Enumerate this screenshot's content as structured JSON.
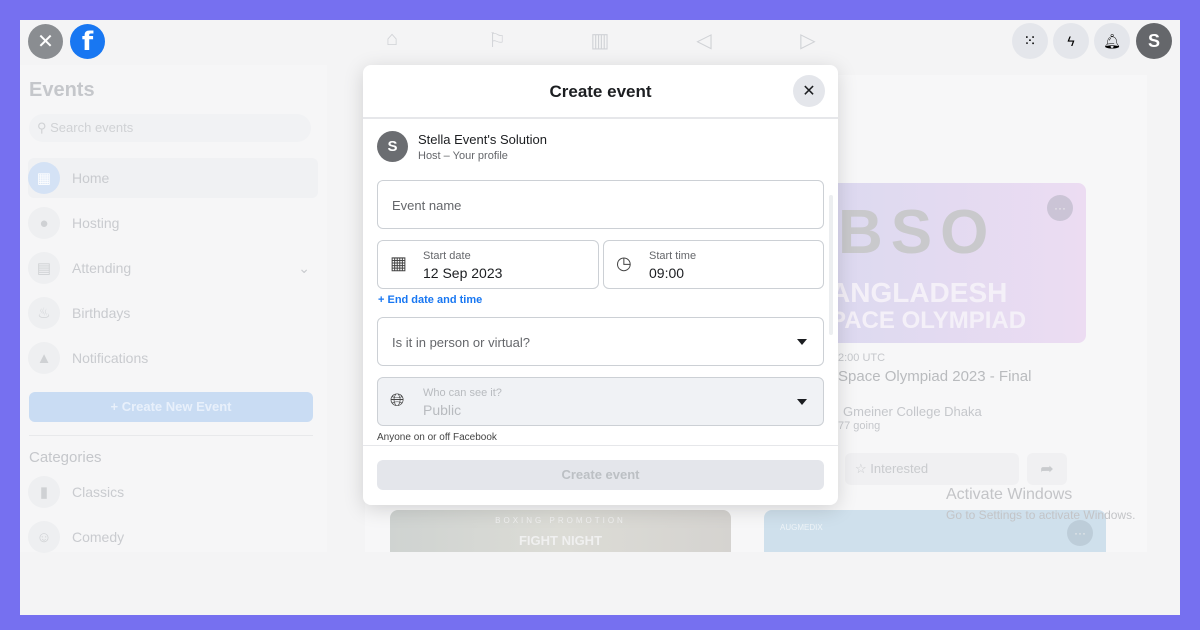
{
  "colors": {
    "border": "#7670f0",
    "accent": "#1877f2",
    "fb_blue": "#1877f2"
  },
  "topbar": {
    "close_icon": "close-icon",
    "logo": "facebook-logo",
    "nav": [
      "home-icon",
      "flag-icon",
      "chart-icon",
      "megaphone-icon",
      "video-icon"
    ],
    "right": [
      "grid-menu-icon",
      "messenger-icon",
      "bell-icon"
    ],
    "avatar_letter": "S"
  },
  "sidebar": {
    "title": "Events",
    "search_placeholder": "Search events",
    "items": [
      {
        "label": "Home",
        "icon": "calendar-icon"
      },
      {
        "label": "Hosting",
        "icon": "person-icon"
      },
      {
        "label": "Attending",
        "icon": "calendar-star-icon"
      },
      {
        "label": "Birthdays",
        "icon": "cake-icon"
      },
      {
        "label": "Notifications",
        "icon": "bell-icon"
      }
    ],
    "create_button": "+ Create New Event",
    "categories_title": "Categories",
    "categories": [
      {
        "label": "Classics",
        "icon": "book-icon"
      },
      {
        "label": "Comedy",
        "icon": "laugh-icon"
      }
    ]
  },
  "background_card": {
    "banner_line1": "BSO",
    "banner_line2": "ANGLADESH",
    "banner_line3": "PACE OLYMPIAD",
    "time": "2:00 UTC",
    "title": "Space Olympiad 2023 - Final",
    "location": "Gmeiner College Dhaka",
    "going": "77 going",
    "interested": "Interested"
  },
  "bottom_cards": {
    "card1_top": "BOXING PROMOTION",
    "card1_title": "FIGHT NIGHT",
    "card2_brand": "AUGMEDIX"
  },
  "watermark": {
    "title": "Activate Windows",
    "subtitle": "Go to Settings to activate Windows."
  },
  "modal": {
    "title": "Create event",
    "host_letter": "S",
    "host_name": "Stella Event's Solution",
    "host_sub": "Host – Your profile",
    "event_name_placeholder": "Event name",
    "start_date_label": "Start date",
    "start_date": "12 Sep 2023",
    "start_time_label": "Start time",
    "start_time": "09:00",
    "end_link": "+ End date and time",
    "location_placeholder": "Is it in person or virtual?",
    "privacy_label": "Who can see it?",
    "privacy_value": "Public",
    "privacy_note": "Anyone on or off Facebook",
    "submit": "Create event"
  }
}
